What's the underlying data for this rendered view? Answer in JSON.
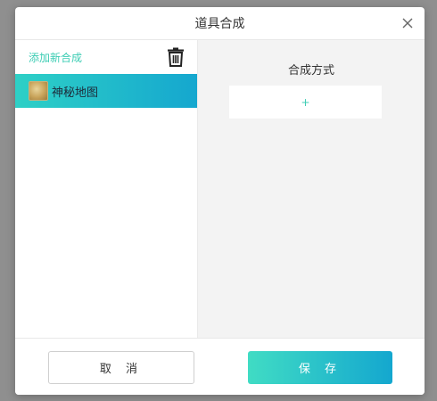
{
  "dialog": {
    "title": "道具合成"
  },
  "left_panel": {
    "add_link": "添加新合成",
    "items": [
      {
        "label": "神秘地图",
        "selected": true
      }
    ]
  },
  "right_panel": {
    "title": "合成方式",
    "add_symbol": "+"
  },
  "footer": {
    "cancel_label": "取 消",
    "save_label": "保 存"
  },
  "colors": {
    "accent": "#3dcdb4",
    "selection_gradient_start": "#2ed0c6",
    "selection_gradient_end": "#15a7cf"
  },
  "icons": {
    "close": "close-icon",
    "delete": "trash-icon",
    "item_thumbnail": "map-thumbnail-icon"
  }
}
